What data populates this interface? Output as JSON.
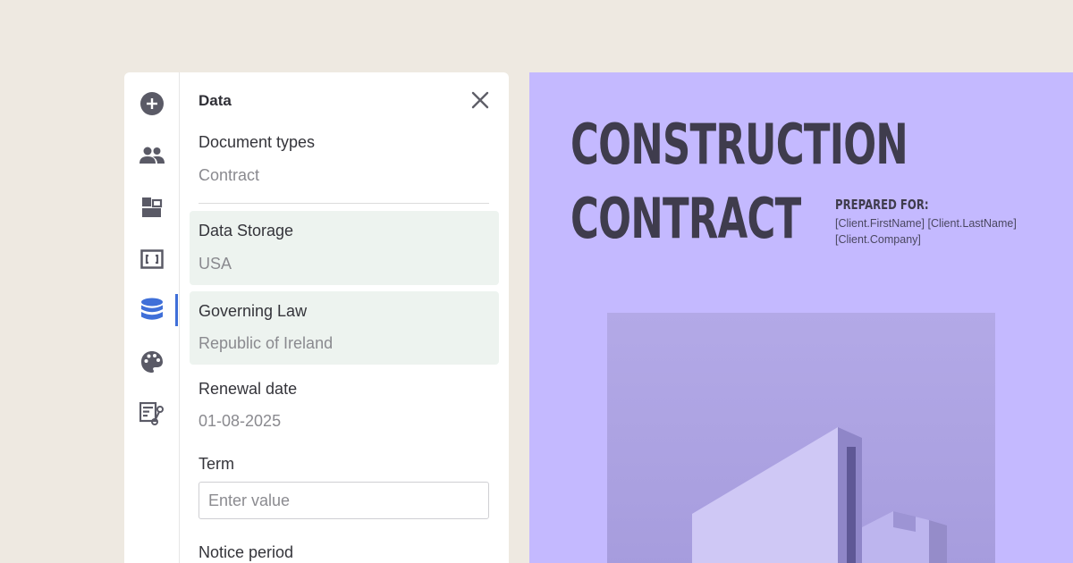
{
  "sidebar": {
    "rail": [
      {
        "icon": "add-circle-icon"
      },
      {
        "icon": "people-icon"
      },
      {
        "icon": "layout-blocks-icon"
      },
      {
        "icon": "fields-frame-icon"
      },
      {
        "icon": "database-icon",
        "active": true
      },
      {
        "icon": "palette-icon"
      },
      {
        "icon": "workflow-form-icon"
      }
    ],
    "title": "Data",
    "fields": {
      "document_types": {
        "label": "Document types",
        "value": "Contract"
      },
      "data_storage": {
        "label": "Data Storage",
        "value": "USA"
      },
      "governing_law": {
        "label": "Governing Law",
        "value": "Republic of Ireland"
      },
      "renewal_date": {
        "label": "Renewal date",
        "value": "01-08-2025"
      },
      "term": {
        "label": "Term",
        "placeholder": "Enter value",
        "value": ""
      },
      "notice_period": {
        "label": "Notice period"
      }
    },
    "highlight_color": "#edf3ef",
    "accent_color": "#3f6fd8"
  },
  "document": {
    "title_line1": "CONSTRUCTION",
    "title_line2": "CONTRACT",
    "prepared_for_label": "PREPARED FOR:",
    "client_name": "[Client.FirstName] [Client.LastName]",
    "client_company": "[Client.Company]",
    "background_color": "#c4b9ff"
  }
}
